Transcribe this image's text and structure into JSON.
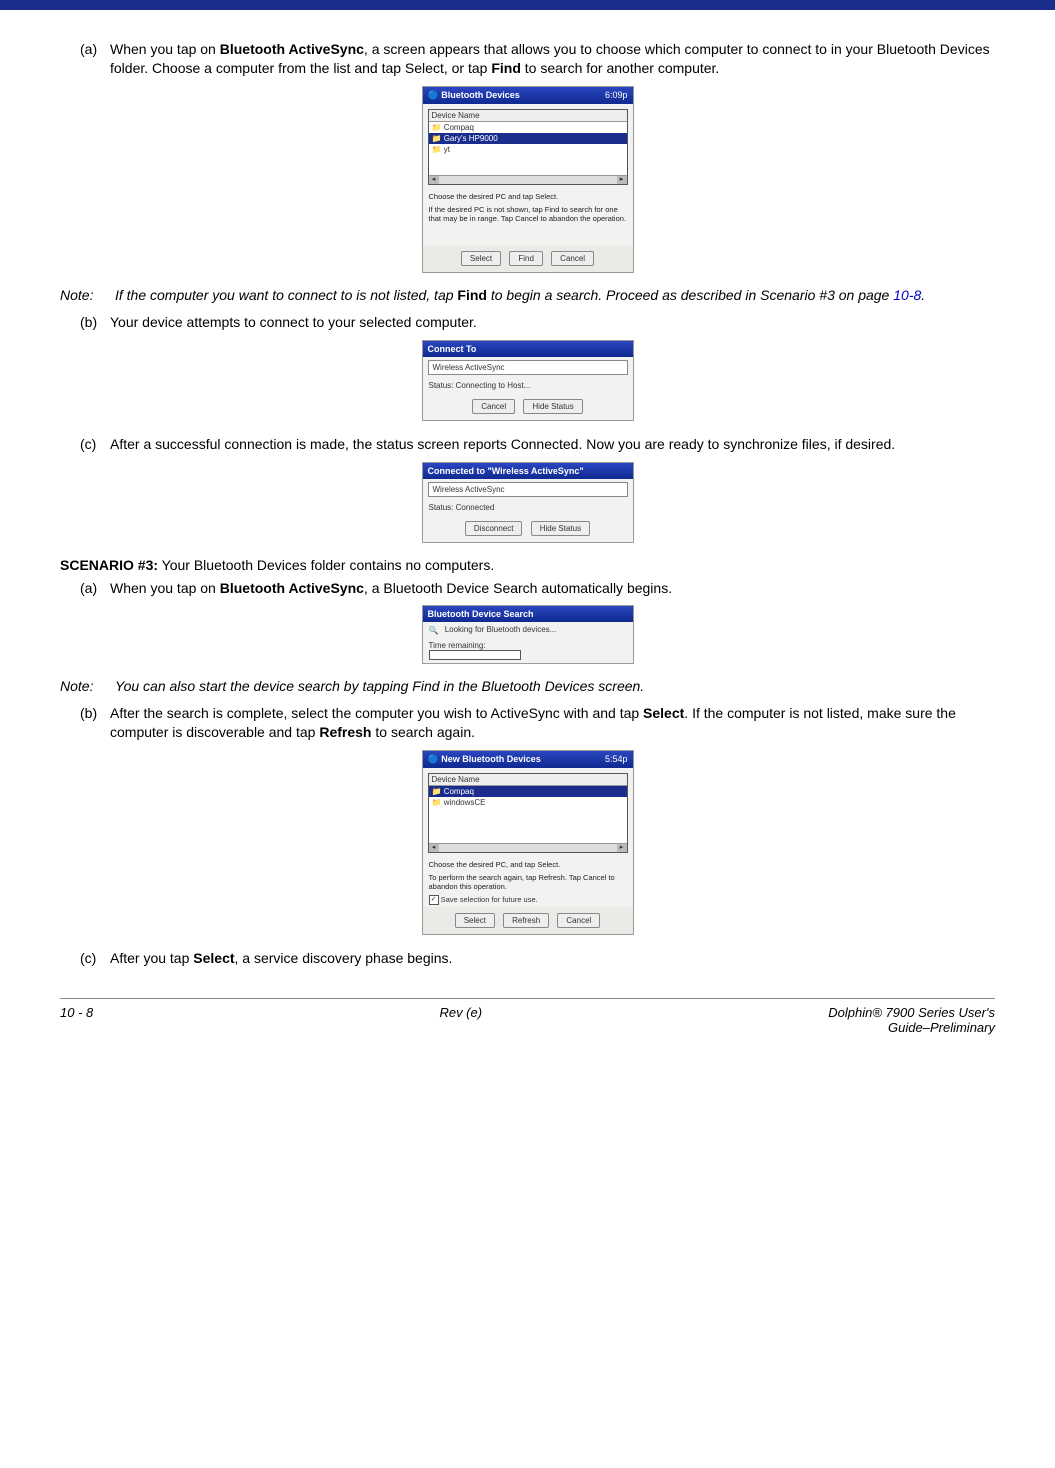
{
  "items": {
    "a1": {
      "letter": "(a)",
      "pre": "When you tap on ",
      "bold1": "Bluetooth ActiveSync",
      "mid": ", a screen appears that allows you to choose which computer to connect to in your Bluetooth Devices folder. Choose a computer from the list and tap Select, or tap ",
      "bold2": "Find",
      "post": " to search for another computer."
    },
    "b1": {
      "letter": "(b)",
      "text": "Your device attempts to connect to your selected computer."
    },
    "c1": {
      "letter": "(c)",
      "text": "After a successful connection is made, the status screen reports Connected. Now you are ready to synchronize files, if desired."
    },
    "a2": {
      "letter": "(a)",
      "pre": "When you tap on ",
      "bold1": "Bluetooth ActiveSync",
      "post": ", a Bluetooth Device Search automatically begins."
    },
    "b2": {
      "letter": "(b)",
      "pre": "After the search is complete, select the computer you wish to ActiveSync with and tap ",
      "bold1": "Select",
      "mid": ". If the computer is not listed, make sure the computer is discoverable and tap ",
      "bold2": "Refresh",
      "post": " to search again."
    },
    "c2": {
      "letter": "(c)",
      "pre": "After you tap ",
      "bold1": "Select",
      "post": ", a service discovery phase begins."
    }
  },
  "note1": {
    "label": "Note:",
    "pre": "If the computer you want to connect to is not listed, tap ",
    "bold": "Find",
    "mid": " to begin a search. Proceed as described in Scenario #3 on page ",
    "link": "10-8",
    "post": "."
  },
  "note2": {
    "label": "Note:",
    "text": "You can also start the device search by tapping Find in the Bluetooth Devices screen."
  },
  "scenario3": {
    "bold": "SCENARIO #3:",
    "text": " Your Bluetooth Devices folder contains no computers."
  },
  "shot1": {
    "title": "Bluetooth Devices",
    "clock": "6:09p",
    "header": "Device Name",
    "row1": "Compaq",
    "row2": "Gary's HP9000",
    "row3": "yt",
    "hint1": "Choose the desired PC and tap Select.",
    "hint2": "If the desired PC is not shown, tap Find to search for one that may be in range. Tap Cancel to abandon the operation.",
    "btn1": "Select",
    "btn2": "Find",
    "btn3": "Cancel"
  },
  "shot2": {
    "title": "Connect To",
    "field": "Wireless ActiveSync",
    "status": "Status:  Connecting to Host...",
    "btn1": "Cancel",
    "btn2": "Hide Status"
  },
  "shot3": {
    "title": "Connected to \"Wireless ActiveSync\"",
    "field": "Wireless ActiveSync",
    "status": "Status:  Connected",
    "btn1": "Disconnect",
    "btn2": "Hide Status"
  },
  "shot4": {
    "title": "Bluetooth Device Search",
    "line1": "Looking for Bluetooth devices...",
    "line2label": "Time remaining:"
  },
  "shot5": {
    "title": "New Bluetooth Devices",
    "clock": "5:54p",
    "header": "Device Name",
    "row1": "Compaq",
    "row2": "windowsCE",
    "hint1": "Choose the desired PC, and tap Select.",
    "hint2": "To perform the search again, tap Refresh. Tap Cancel to abandon this operation.",
    "check": "Save selection for future use.",
    "btn1": "Select",
    "btn2": "Refresh",
    "btn3": "Cancel"
  },
  "footer": {
    "left": "10 - 8",
    "mid": "Rev (e)",
    "right1": "Dolphin® 7900 Series User's",
    "right2": "Guide–Preliminary"
  }
}
